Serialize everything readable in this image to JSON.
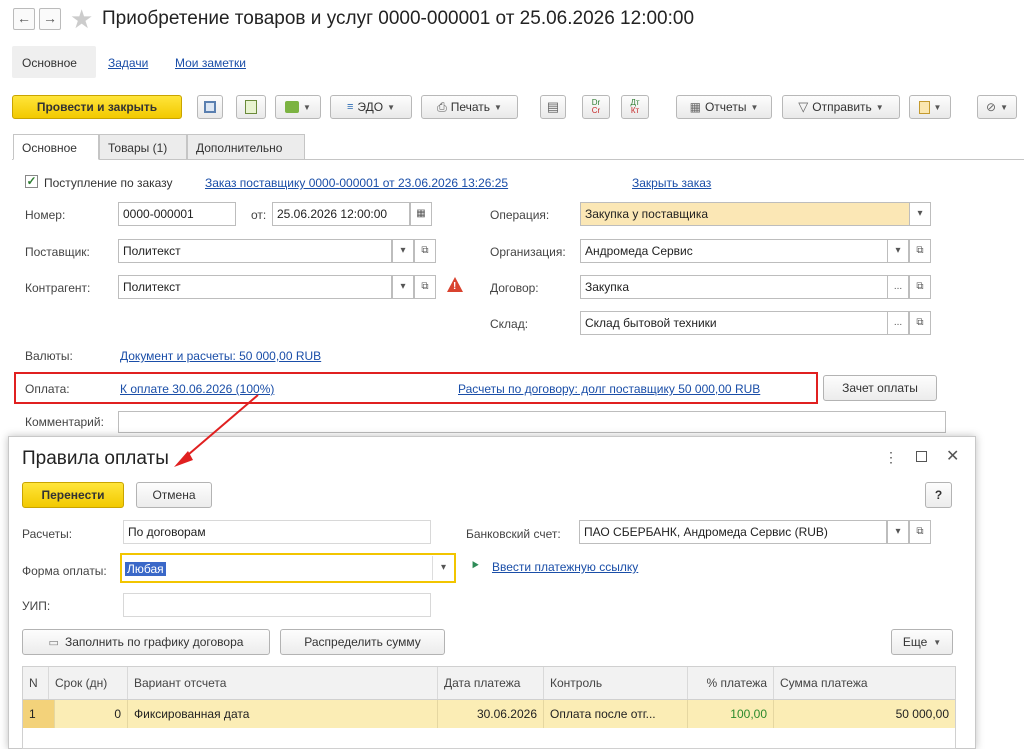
{
  "window": {
    "title": "Приобретение товаров и услуг 0000-000001 от 25.06.2026 12:00:00",
    "nav_back": "←",
    "nav_forward": "→",
    "star": "★"
  },
  "section_tabs": [
    "Основное",
    "Задачи",
    "Мои заметки"
  ],
  "toolbar": {
    "post_close": "Провести и закрыть",
    "edo": "ЭДО",
    "print": "Печать",
    "dr_top": "Dr",
    "dr_bottom": "Cr",
    "dt_top": "Дт",
    "dt_bottom": "Кт",
    "reports": "Отчеты",
    "send": "Отправить"
  },
  "form_tabs": [
    "Основное",
    "Товары (1)",
    "Дополнительно"
  ],
  "order": {
    "checkbox_label": "Поступление по заказу",
    "order_link": "Заказ поставщику 0000-000001 от 23.06.2026 13:26:25",
    "close_order": "Закрыть заказ"
  },
  "fields": {
    "number_label": "Номер:",
    "number_value": "0000-000001",
    "date_label": "от:",
    "date_value": "25.06.2026 12:00:00",
    "supplier_label": "Поставщик:",
    "supplier_value": "Политекст",
    "counterparty_label": "Контрагент:",
    "counterparty_value": "Политекст",
    "operation_label": "Операция:",
    "operation_value": "Закупка у поставщика",
    "org_label": "Организация:",
    "org_value": "Андромеда Сервис",
    "contract_label": "Договор:",
    "contract_value": "Закупка",
    "warehouse_label": "Склад:",
    "warehouse_value": "Склад бытовой техники",
    "currency_label": "Валюты:",
    "currency_link": "Документ и расчеты: 50 000,00 RUB",
    "payment_label": "Оплата:",
    "payment_link": "К оплате 30.06.2026 (100%)",
    "settlements_link": "Расчеты по договору: долг поставщику 50 000,00 RUB",
    "offset_button": "Зачет оплаты",
    "comment_label": "Комментарий:"
  },
  "dialog": {
    "title": "Правила оплаты",
    "transfer_button": "Перенести",
    "cancel_button": "Отмена",
    "help": "?",
    "settlements_label": "Расчеты:",
    "settlements_value": "По договорам",
    "bank_label": "Банковский счет:",
    "bank_value": "ПАО СБЕРБАНК, Андромеда Сервис (RUB)",
    "form_label": "Форма оплаты:",
    "form_value": "Любая",
    "payment_link": "Ввести платежную ссылку",
    "uip_label": "УИП:",
    "fill_schedule": "Заполнить по графику договора",
    "distribute": "Распределить сумму",
    "more": "Еще",
    "columns": [
      "N",
      "Срок (дн)",
      "Вариант отсчета",
      "Дата платежа",
      "Контроль",
      "% платежа",
      "Сумма платежа"
    ],
    "rows": [
      {
        "n": "1",
        "days": "0",
        "variant": "Фиксированная дата",
        "date": "30.06.2026",
        "control": "Оплата после отг...",
        "percent": "100,00",
        "sum": "50 000,00"
      }
    ]
  },
  "colors": {
    "accent_yellow": "#f5d000",
    "highlight_red": "#e02020",
    "link_blue": "#1a4ea8",
    "row_yellow": "#fbedb5",
    "percent_green": "#2c8a2c"
  }
}
